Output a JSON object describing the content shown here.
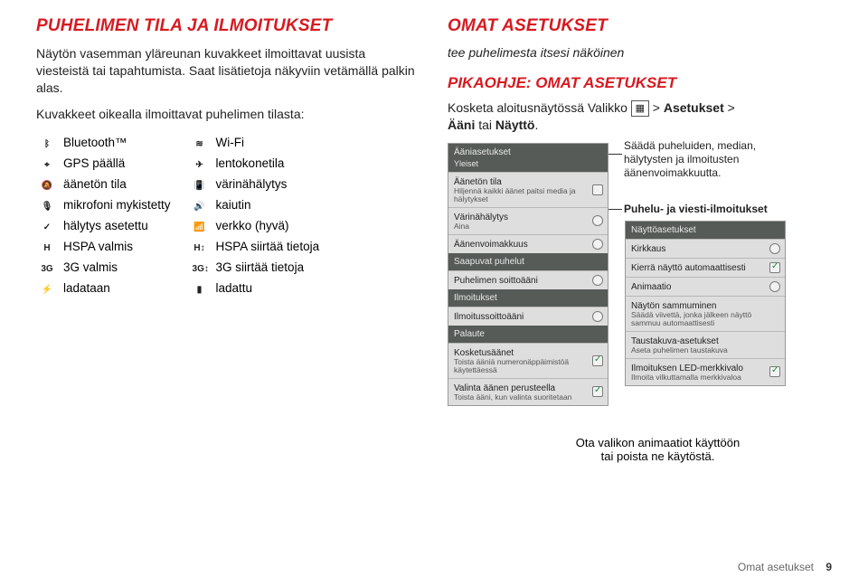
{
  "left": {
    "heading": "PUHELIMEN TILA JA ILMOITUKSET",
    "para": "Näytön vasemman yläreunan kuvakkeet ilmoittavat uusista viesteistä tai tapahtumista. Saat lisätietoja näkyviin vetämällä palkin alas.",
    "tableIntro": "Kuvakkeet oikealla ilmoittavat puhelimen tilasta:",
    "rows": [
      {
        "i1": "bluetooth-icon",
        "g1": "ᛒ",
        "l1": "Bluetooth™",
        "i2": "wifi-icon",
        "g2": "≋",
        "l2": "Wi-Fi"
      },
      {
        "i1": "gps-icon",
        "g1": "⌖",
        "l1": "GPS päällä",
        "i2": "airplane-icon",
        "g2": "✈",
        "l2": "lentokonetila"
      },
      {
        "i1": "mute-icon",
        "g1": "🔕",
        "l1": "äänetön tila",
        "i2": "vibrate-icon",
        "g2": "📳",
        "l2": "värinähälytys"
      },
      {
        "i1": "mic-mute-icon",
        "g1": "🎙",
        "l1": "mikrofoni mykistetty",
        "i2": "speaker-icon",
        "g2": "🔊",
        "l2": "kaiutin"
      },
      {
        "i1": "alarm-icon",
        "g1": "✓",
        "l1": "hälytys asetettu",
        "i2": "signal-icon",
        "g2": "📶",
        "l2": "verkko (hyvä)"
      },
      {
        "i1": "hspa-icon",
        "g1": "H",
        "l1": "HSPA valmis",
        "i2": "hspa-tx-icon",
        "g2": "H↕",
        "l2": "HSPA siirtää tietoja"
      },
      {
        "i1": "3g-icon",
        "g1": "3G",
        "l1": "3G valmis",
        "i2": "3g-tx-icon",
        "g2": "3G↕",
        "l2": "3G siirtää tietoja"
      },
      {
        "i1": "charging-icon",
        "g1": "⚡",
        "l1": "ladataan",
        "i2": "charged-icon",
        "g2": "▮",
        "l2": "ladattu"
      }
    ]
  },
  "right": {
    "heading": "OMAT ASETUKSET",
    "subtitle": "tee puhelimesta itsesi näköinen",
    "quickHeading": "PIKAOHJE: OMAT ASETUKSET",
    "instrPre": "Kosketa aloitusnäytössä Valikko ",
    "instrMid": " > ",
    "instrBold1": "Asetukset",
    "instrMid2": " > ",
    "instrBold2": "Ääni",
    "instrOr": " tai ",
    "instrBold3": "Näyttö",
    "instrDot": ".",
    "panelLeft": {
      "h1": "Ääniasetukset",
      "h1b": "Yleiset",
      "i1t": "Äänetön tila",
      "i1s": "Hiljennä kaikki äänet paitsi media ja hälytykset",
      "i2t": "Värinähälytys",
      "i2s": "Aina",
      "i3t": "Äänenvoimakkuus",
      "h2": "Saapuvat puhelut",
      "i4t": "Puhelimen soittoääni",
      "h3": "Ilmoitukset",
      "i5t": "Ilmoitussoittoääni",
      "h4": "Palaute",
      "i6t": "Kosketusäänet",
      "i6s": "Toista ääniä numeronäppäimistöä käytettäessä",
      "i7t": "Valinta äänen perusteella",
      "i7s": "Toista ääni, kun valinta suoritetaan"
    },
    "panelRight": {
      "h1": "Näyttöasetukset",
      "i1t": "Kirkkaus",
      "i2t": "Kierrä näyttö automaattisesti",
      "i3t": "Animaatio",
      "i4t": "Näytön sammuminen",
      "i4s": "Säädä viivettä, jonka jälkeen näyttö sammuu automaattisesti",
      "i5t": "Taustakuva-asetukset",
      "i5s": "Aseta puhelimen taustakuva",
      "i6t": "Ilmoituksen LED-merkkivalo",
      "i6s": "Ilmoita vilkuttamalla merkkivaloa"
    },
    "callouts": {
      "vol": "Säädä puheluiden, median, hälytysten ja ilmoitusten äänenvoimakkuutta.",
      "notif": "Puhelu- ja viesti-ilmoitukset"
    },
    "bottomCaption": "Ota valikon animaatiot käyttöön\ntai poista ne käytöstä."
  },
  "footer": {
    "section": "Omat asetukset",
    "page": "9"
  }
}
